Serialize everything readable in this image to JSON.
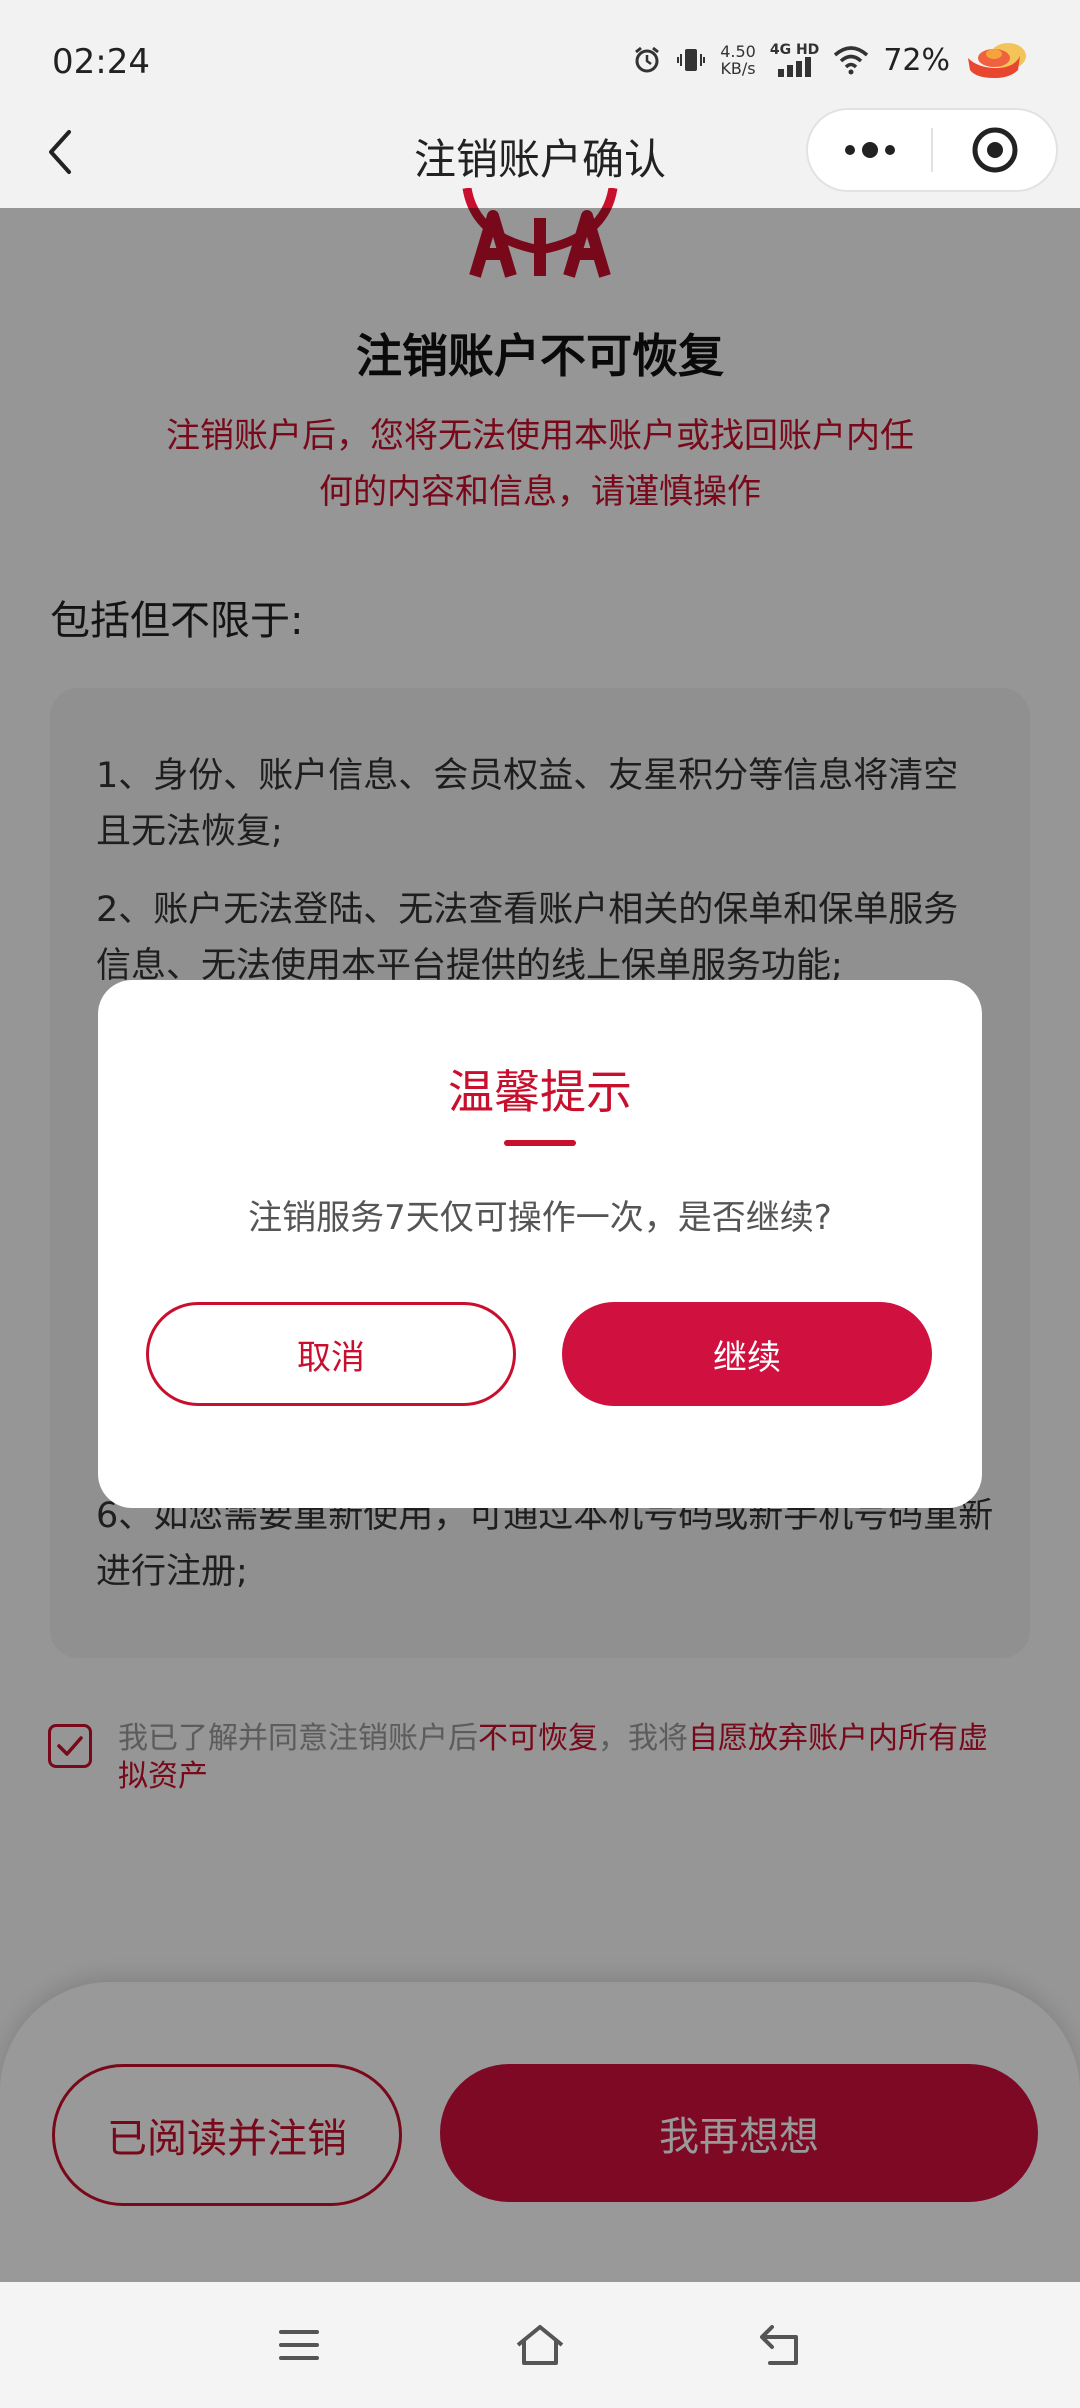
{
  "status": {
    "time": "02:24",
    "net_speed_value": "4.50",
    "net_speed_unit": "KB/s",
    "signal_label": "4G HD",
    "battery": "72%"
  },
  "nav": {
    "title": "注销账户确认"
  },
  "content": {
    "warning_title": "注销账户不可恢复",
    "warning_desc": "注销账户后，您将无法使用本账户或找回账户内任何的内容和信息，请谨慎操作",
    "includes_label": "包括但不限于:",
    "items": [
      "1、身份、账户信息、会员权益、友星积分等信息将清空且无法恢复;",
      "2、账户无法登陆、无法查看账户相关的保单和保单服务信息、无法使用本平台提供的线上保单服务功能;",
      "6、如您需要重新使用，可通过本机号码或新手机号码重新进行注册;"
    ],
    "agree_prefix": "我已了解并同意注销账户后",
    "agree_hl1": "不可恢复",
    "agree_mid": "，我将",
    "agree_hl2": "自愿放弃账户内所有虚拟资产"
  },
  "bottom": {
    "read_cancel_label": "已阅读并注销",
    "rethink_label": "我再想想"
  },
  "dialog": {
    "title": "温馨提示",
    "message": "注销服务7天仅可操作一次，是否继续?",
    "cancel_label": "取消",
    "continue_label": "继续"
  },
  "colors": {
    "brand_red": "#c8102e",
    "button_red": "#d0103f"
  }
}
